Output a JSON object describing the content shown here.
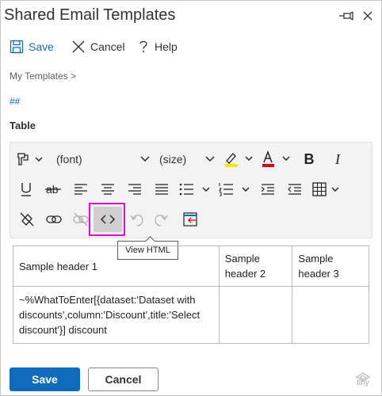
{
  "window": {
    "title": "Shared Email Templates",
    "pin_icon": "pin-icon",
    "close_icon": "close-icon"
  },
  "commands": {
    "save_label": "Save",
    "cancel_label": "Cancel",
    "help_label": "Help",
    "save_icon": "floppy-disk-icon",
    "cancel_icon": "close-icon",
    "help_icon": "question-mark-icon"
  },
  "breadcrumb": "My Templates >",
  "template_name": "##",
  "section_label": "Table",
  "toolbar": {
    "font_select": "(font)",
    "size_select": "(size)",
    "highlight_color": "#f7e700",
    "font_color": "#e3001b",
    "tooltip": "View HTML"
  },
  "table": {
    "header": [
      "Sample header 1",
      "Sample header 2",
      "Sample header 3"
    ],
    "rows": [
      [
        "~%WhatToEnter[{dataset:'Dataset with discounts',column:'Discount',title:'Select discount'}] discount",
        "",
        ""
      ]
    ]
  },
  "footer": {
    "save_label": "Save",
    "cancel_label": "Cancel",
    "branding": "tiny"
  },
  "colors": {
    "accent": "#0f6cbd",
    "highlight_border": "#e10adf"
  }
}
